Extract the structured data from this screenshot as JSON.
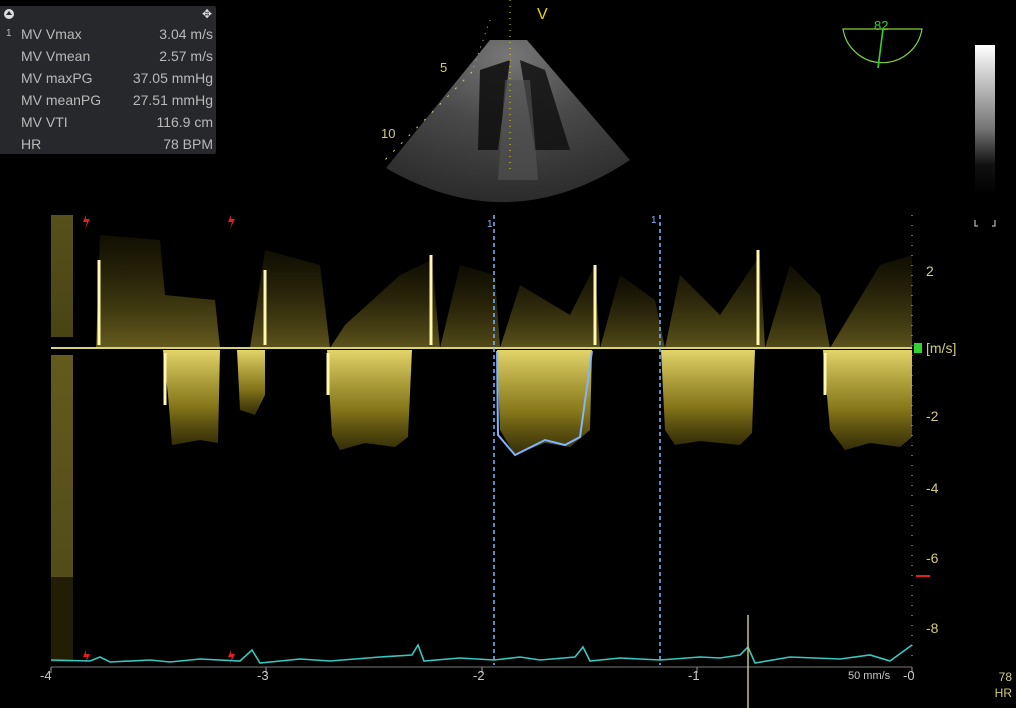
{
  "measurements": {
    "index": "1",
    "rows": [
      {
        "label": "MV Vmax",
        "value": "3.04 m/s"
      },
      {
        "label": "MV Vmean",
        "value": "2.57 m/s"
      },
      {
        "label": "MV maxPG",
        "value": "37.05 mmHg"
      },
      {
        "label": "MV meanPG",
        "value": "27.51 mmHg"
      },
      {
        "label": "MV VTI",
        "value": "116.9 cm"
      },
      {
        "label": "HR",
        "value": "78 BPM"
      }
    ]
  },
  "sector": {
    "mode_label": "V",
    "depth_labels": [
      "5",
      "10"
    ]
  },
  "probe": {
    "angle": "82"
  },
  "doppler": {
    "velocity_unit": "[m/s]",
    "velocity_ticks": [
      "2",
      "-2",
      "-4",
      "-6",
      "-8"
    ],
    "time_ticks": [
      "-4",
      "-3",
      "-2",
      "-1",
      "-0"
    ],
    "sweep_speed": "50 mm/s",
    "cursor_markers": [
      "1",
      "1"
    ]
  },
  "hr": {
    "value": "78",
    "label": "HR"
  },
  "colors": {
    "doppler": "#d8c340",
    "ecg": "#36c9c0",
    "trace": "#7fb4ff",
    "scale": "#d4cc7a",
    "accent_green": "#2fd42f",
    "marker_red": "#e02020"
  }
}
